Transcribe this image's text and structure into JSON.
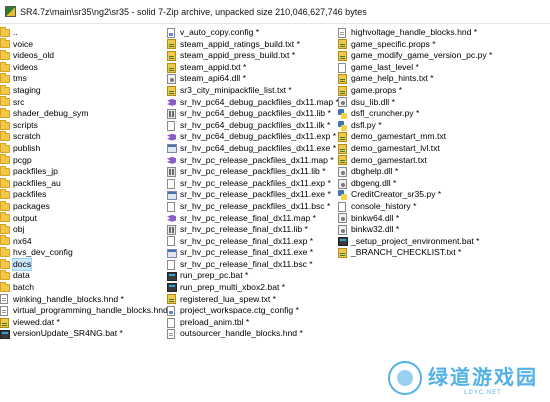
{
  "window": {
    "title": "SR4.7z\\main\\sr35\\ng2\\sr35 - solid 7-Zip archive, unpacked size 210,046,627,746 bytes"
  },
  "columns": [
    [
      {
        "label": "..",
        "icon": "folder"
      },
      {
        "label": "voice",
        "icon": "folder"
      },
      {
        "label": "videos_old",
        "icon": "folder"
      },
      {
        "label": "videos",
        "icon": "folder"
      },
      {
        "label": "tms",
        "icon": "folder"
      },
      {
        "label": "staging",
        "icon": "folder"
      },
      {
        "label": "src",
        "icon": "folder"
      },
      {
        "label": "shader_debug_sym",
        "icon": "folder"
      },
      {
        "label": "scripts",
        "icon": "folder"
      },
      {
        "label": "scratch",
        "icon": "folder"
      },
      {
        "label": "publish",
        "icon": "folder"
      },
      {
        "label": "pcgp",
        "icon": "folder"
      },
      {
        "label": "packfiles_jp",
        "icon": "folder"
      },
      {
        "label": "packfiles_au",
        "icon": "folder"
      },
      {
        "label": "packfiles",
        "icon": "folder"
      },
      {
        "label": "packages",
        "icon": "folder"
      },
      {
        "label": "output",
        "icon": "folder"
      },
      {
        "label": "obj",
        "icon": "folder"
      },
      {
        "label": "nx64",
        "icon": "folder"
      },
      {
        "label": "hvs_dev_config",
        "icon": "folder"
      },
      {
        "label": "docs",
        "icon": "folder",
        "selected": true
      },
      {
        "label": "data",
        "icon": "folder"
      },
      {
        "label": "batch",
        "icon": "folder"
      },
      {
        "label": "winking_handle_blocks.hnd *",
        "icon": "hnd"
      },
      {
        "label": "virtual_programming_handle_blocks.hnd *",
        "icon": "hnd"
      },
      {
        "label": "viewed.dat *",
        "icon": "props"
      },
      {
        "label": "versionUpdate_SR4NG.bat *",
        "icon": "bat"
      }
    ],
    [
      {
        "label": "v_auto_copy.config *",
        "icon": "config"
      },
      {
        "label": "steam_appid_ratings_build.txt *",
        "icon": "props"
      },
      {
        "label": "steam_appid_press_build.txt *",
        "icon": "props"
      },
      {
        "label": "steam_appid.txt *",
        "icon": "props"
      },
      {
        "label": "steam_api64.dll *",
        "icon": "dll"
      },
      {
        "label": "sr3_city_minipackfile_list.txt *",
        "icon": "props"
      },
      {
        "label": "sr_hv_pc64_debug_packfiles_dx11.map *",
        "icon": "vs"
      },
      {
        "label": "sr_hv_pc64_debug_packfiles_dx11.lib *",
        "icon": "lib"
      },
      {
        "label": "sr_hv_pc64_debug_packfiles_dx11.ilk *",
        "icon": "file"
      },
      {
        "label": "sr_hv_pc64_debug_packfiles_dx11.exp *",
        "icon": "vs"
      },
      {
        "label": "sr_hv_pc64_debug_packfiles_dx11.exe *",
        "icon": "exe"
      },
      {
        "label": "sr_hv_pc_release_packfiles_dx11.map *",
        "icon": "vs"
      },
      {
        "label": "sr_hv_pc_release_packfiles_dx11.lib *",
        "icon": "lib"
      },
      {
        "label": "sr_hv_pc_release_packfiles_dx11.exp *",
        "icon": "file"
      },
      {
        "label": "sr_hv_pc_release_packfiles_dx11.exe *",
        "icon": "exe"
      },
      {
        "label": "sr_hv_pc_release_packfiles_dx11.bsc *",
        "icon": "file"
      },
      {
        "label": "sr_hv_pc_release_final_dx11.map *",
        "icon": "vs"
      },
      {
        "label": "sr_hv_pc_release_final_dx11.lib *",
        "icon": "lib"
      },
      {
        "label": "sr_hv_pc_release_final_dx11.exp *",
        "icon": "file"
      },
      {
        "label": "sr_hv_pc_release_final_dx11.exe *",
        "icon": "exe"
      },
      {
        "label": "sr_hv_pc_release_final_dx11.bsc *",
        "icon": "file"
      },
      {
        "label": "run_prep_pc.bat *",
        "icon": "bat"
      },
      {
        "label": "run_prep_multi_xbox2.bat *",
        "icon": "bat"
      },
      {
        "label": "registered_lua_spew.txt *",
        "icon": "props"
      },
      {
        "label": "project_workspace.ctg_config *",
        "icon": "config"
      },
      {
        "label": "preload_anim.tbl *",
        "icon": "file"
      },
      {
        "label": "outsourcer_handle_blocks.hnd *",
        "icon": "hnd"
      }
    ],
    [
      {
        "label": "highvoltage_handle_blocks.hnd *",
        "icon": "hnd"
      },
      {
        "label": "game_specific.props *",
        "icon": "props"
      },
      {
        "label": "game_modify_game_version_pc.py *",
        "icon": "props"
      },
      {
        "label": "game_last_level *",
        "icon": "file"
      },
      {
        "label": "game_help_hints.txt *",
        "icon": "props"
      },
      {
        "label": "game.props *",
        "icon": "props"
      },
      {
        "label": "dsu_lib.dll *",
        "icon": "dll"
      },
      {
        "label": "dsfl_cruncher.py *",
        "icon": "py"
      },
      {
        "label": "dsfl.py *",
        "icon": "py"
      },
      {
        "label": "demo_gamestart_mm.txt",
        "icon": "props"
      },
      {
        "label": "demo_gamestart_lvl.txt",
        "icon": "props"
      },
      {
        "label": "demo_gamestart.txt",
        "icon": "props"
      },
      {
        "label": "dbghelp.dll *",
        "icon": "dll"
      },
      {
        "label": "dbgeng.dll *",
        "icon": "dll"
      },
      {
        "label": "CreditCreator_sr35.py *",
        "icon": "py"
      },
      {
        "label": "console_history *",
        "icon": "file"
      },
      {
        "label": "binkw64.dll *",
        "icon": "dll"
      },
      {
        "label": "binkw32.dll *",
        "icon": "dll"
      },
      {
        "label": "_setup_project_environment.bat *",
        "icon": "bat"
      },
      {
        "label": "_BRANCH_CHECKLIST.txt *",
        "icon": "props"
      }
    ]
  ],
  "watermark": {
    "main": "绿道游戏园",
    "sub": "LDYC.NET"
  }
}
